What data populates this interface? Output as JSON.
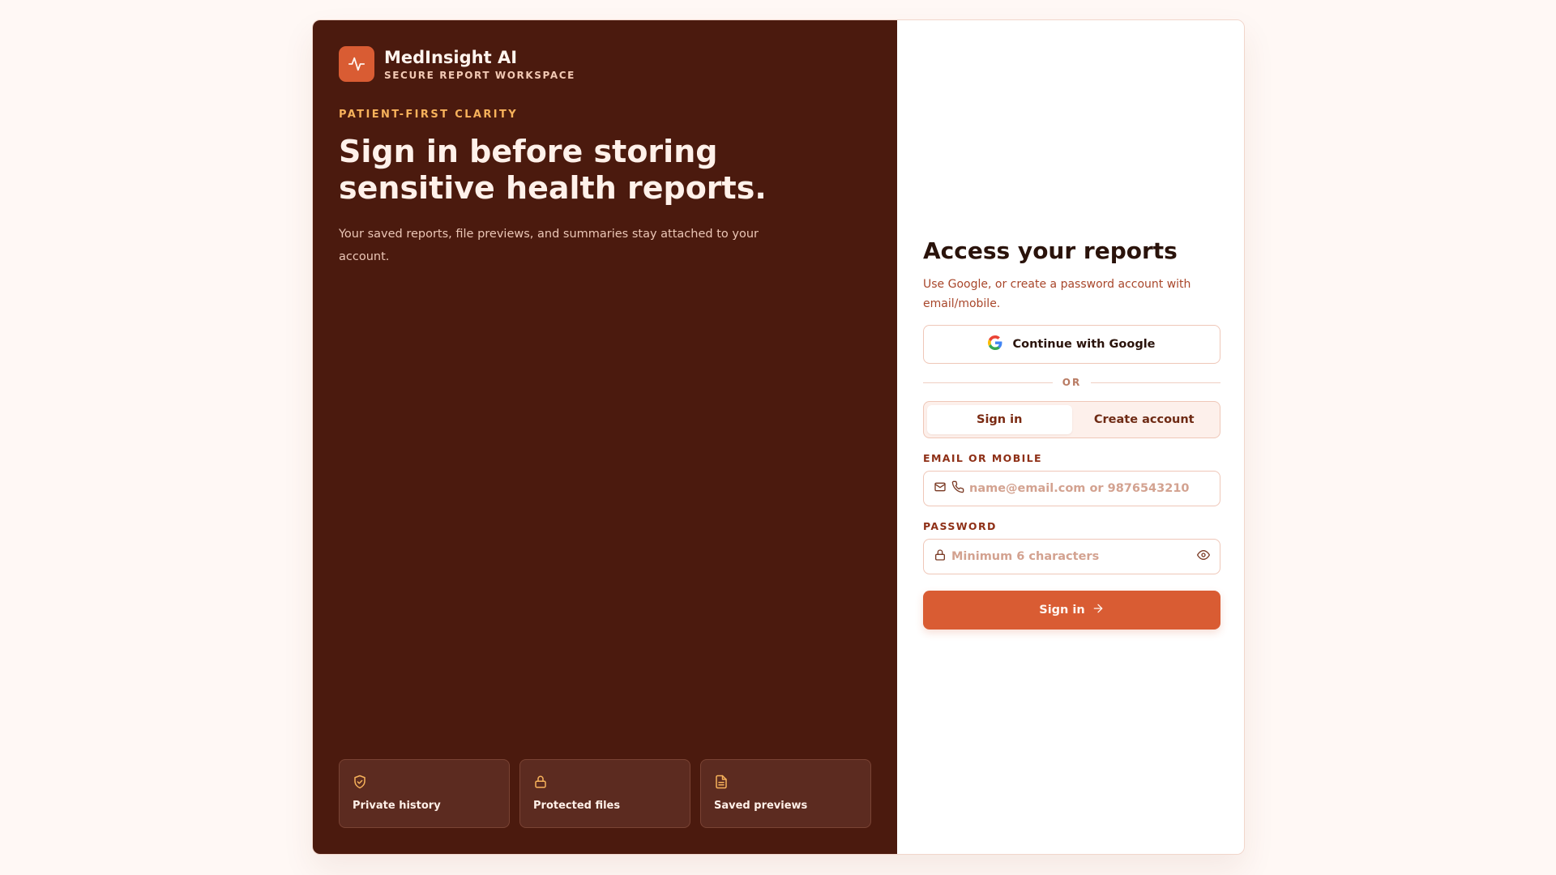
{
  "brand": {
    "name": "MedInsight AI",
    "subtitle": "SECURE REPORT WORKSPACE"
  },
  "hero": {
    "eyebrow": "PATIENT-FIRST CLARITY",
    "headline": "Sign in before storing sensitive health reports.",
    "description": "Your saved reports, file previews, and summaries stay attached to your account."
  },
  "features": [
    {
      "icon": "shield-check-icon",
      "label": "Private history"
    },
    {
      "icon": "lock-icon",
      "label": "Protected files"
    },
    {
      "icon": "document-icon",
      "label": "Saved previews"
    }
  ],
  "auth": {
    "title": "Access your reports",
    "subtitle": "Use Google, or create a password account with email/mobile.",
    "google_label": "Continue with Google",
    "divider": "OR",
    "tabs": [
      {
        "label": "Sign in",
        "active": true
      },
      {
        "label": "Create account",
        "active": false
      }
    ],
    "email_label": "EMAIL OR MOBILE",
    "email_placeholder": "name@email.com or 9876543210",
    "email_value": "",
    "password_label": "PASSWORD",
    "password_placeholder": "Minimum 6 characters",
    "password_value": "",
    "submit_label": "Sign in"
  },
  "colors": {
    "panel_dark": "#4b1a0e",
    "accent": "#d95c33",
    "eyebrow": "#f7b25b",
    "background": "#fff8f5"
  }
}
